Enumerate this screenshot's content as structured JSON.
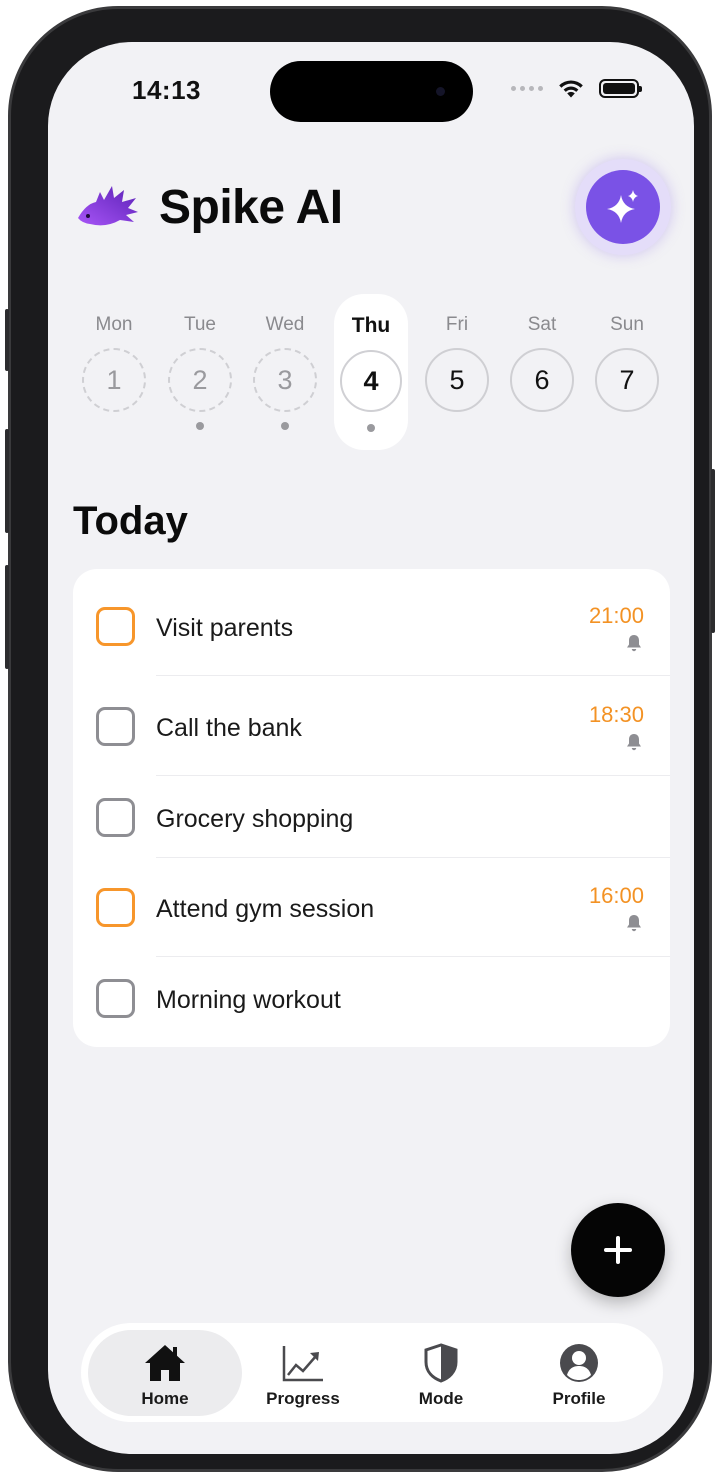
{
  "status_bar": {
    "time": "14:13"
  },
  "header": {
    "app_name": "Spike AI"
  },
  "week": [
    {
      "name": "Mon",
      "number": "1",
      "state": "past",
      "has_dot": false
    },
    {
      "name": "Tue",
      "number": "2",
      "state": "past",
      "has_dot": true
    },
    {
      "name": "Wed",
      "number": "3",
      "state": "past",
      "has_dot": true
    },
    {
      "name": "Thu",
      "number": "4",
      "state": "today",
      "has_dot": true
    },
    {
      "name": "Fri",
      "number": "5",
      "state": "future",
      "has_dot": false
    },
    {
      "name": "Sat",
      "number": "6",
      "state": "future",
      "has_dot": false
    },
    {
      "name": "Sun",
      "number": "7",
      "state": "future",
      "has_dot": false
    }
  ],
  "section": {
    "title": "Today"
  },
  "tasks": [
    {
      "label": "Visit parents",
      "time": "21:00",
      "has_reminder": true,
      "checkbox_color": "orange"
    },
    {
      "label": "Call the bank",
      "time": "18:30",
      "has_reminder": true,
      "checkbox_color": "gray"
    },
    {
      "label": "Grocery shopping",
      "time": "",
      "has_reminder": false,
      "checkbox_color": "gray"
    },
    {
      "label": "Attend gym session",
      "time": "16:00",
      "has_reminder": true,
      "checkbox_color": "orange"
    },
    {
      "label": "Morning workout",
      "time": "",
      "has_reminder": false,
      "checkbox_color": "gray"
    }
  ],
  "tabs": [
    {
      "label": "Home",
      "icon": "home-icon",
      "active": true
    },
    {
      "label": "Progress",
      "icon": "chart-icon",
      "active": false
    },
    {
      "label": "Mode",
      "icon": "shield-icon",
      "active": false
    },
    {
      "label": "Profile",
      "icon": "profile-icon",
      "active": false
    }
  ],
  "colors": {
    "accent_purple": "#7a52e6",
    "time_orange": "#f39224",
    "checkbox_orange": "#f7962b",
    "background": "#f2f2f5"
  }
}
